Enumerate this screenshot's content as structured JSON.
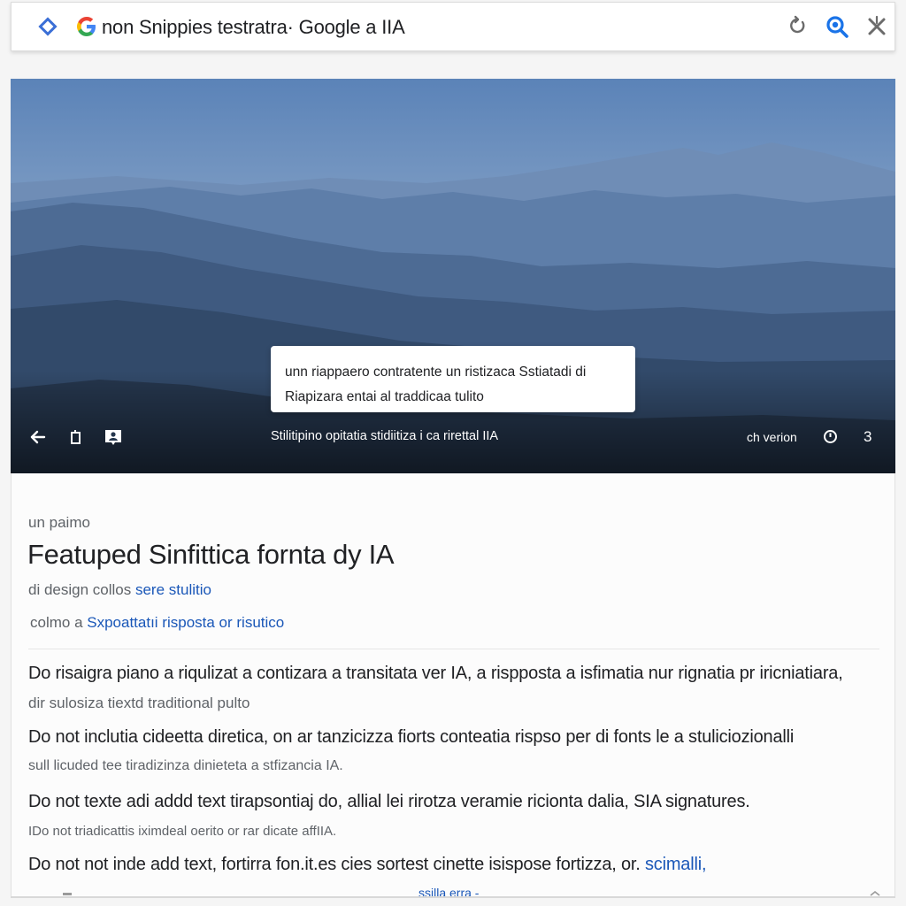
{
  "search": {
    "query": "non Snippies testratra· Google a IIA"
  },
  "hero": {
    "tooltip_line1": "unn riappaero contratente un ristizaca Sstiatadi di",
    "tooltip_line2": "Riaрizara entai al traddicaa tulito",
    "caption": "Stilitipino opitatia stidiitiza i ca rirettal IIA",
    "version": "ch verion",
    "count": "3"
  },
  "card": {
    "eyebrow": "un paimo",
    "title": "Featuped Sinfittica fornta dy IA",
    "sub1_prefix": "di design collos ",
    "sub1_link": "sere stulitio",
    "sub2_prefix": "colmo a ",
    "sub2_link": "Sxpoattatıi risposta or risutico",
    "para1": "Do risaigra piano a riqulizat a contizara a transitata ver IA, a rispposta a isfimatia nur rignatia pr iricniatiara,",
    "note1": "dir sulosiza tiextd traditional pulto",
    "para2": "Do not inclutia cideetta diretica, on ar tanzicizza fiorts conteatia rispso per di fonts le a stuliciozionalli",
    "note2": "sull licuded tee tiradizinza dinieteta a stfizancia IA.",
    "para3": "Do not texte adi addd text tirapsontiaj do, allial lei rirotza veramie ricionta dalia, SIA signatures.",
    "note3": "IDo not triadicattis iximdeal oerito or rar dicate affIIA.",
    "para4_prefix": "Do not not inde add text, fortirra fon.it.es cies sortest cinette isispose fortizza, or. ",
    "para4_link": "scimalli,",
    "cut_text": "ssilla erra -"
  },
  "colors": {
    "link": "#1a57b8",
    "sky_top": "#5f86ba",
    "sky_bottom": "#8aa6c8",
    "mountain": "#4a6a95"
  },
  "icons": {
    "left_badge": "diamond-icon",
    "brand": "google-g-icon",
    "reload": "refresh-icon",
    "lens": "search-zoom-icon",
    "close": "close-icon",
    "back": "back-arrow-icon",
    "frame": "frame-icon",
    "caption": "caption-icon",
    "settings": "settings-icon"
  }
}
